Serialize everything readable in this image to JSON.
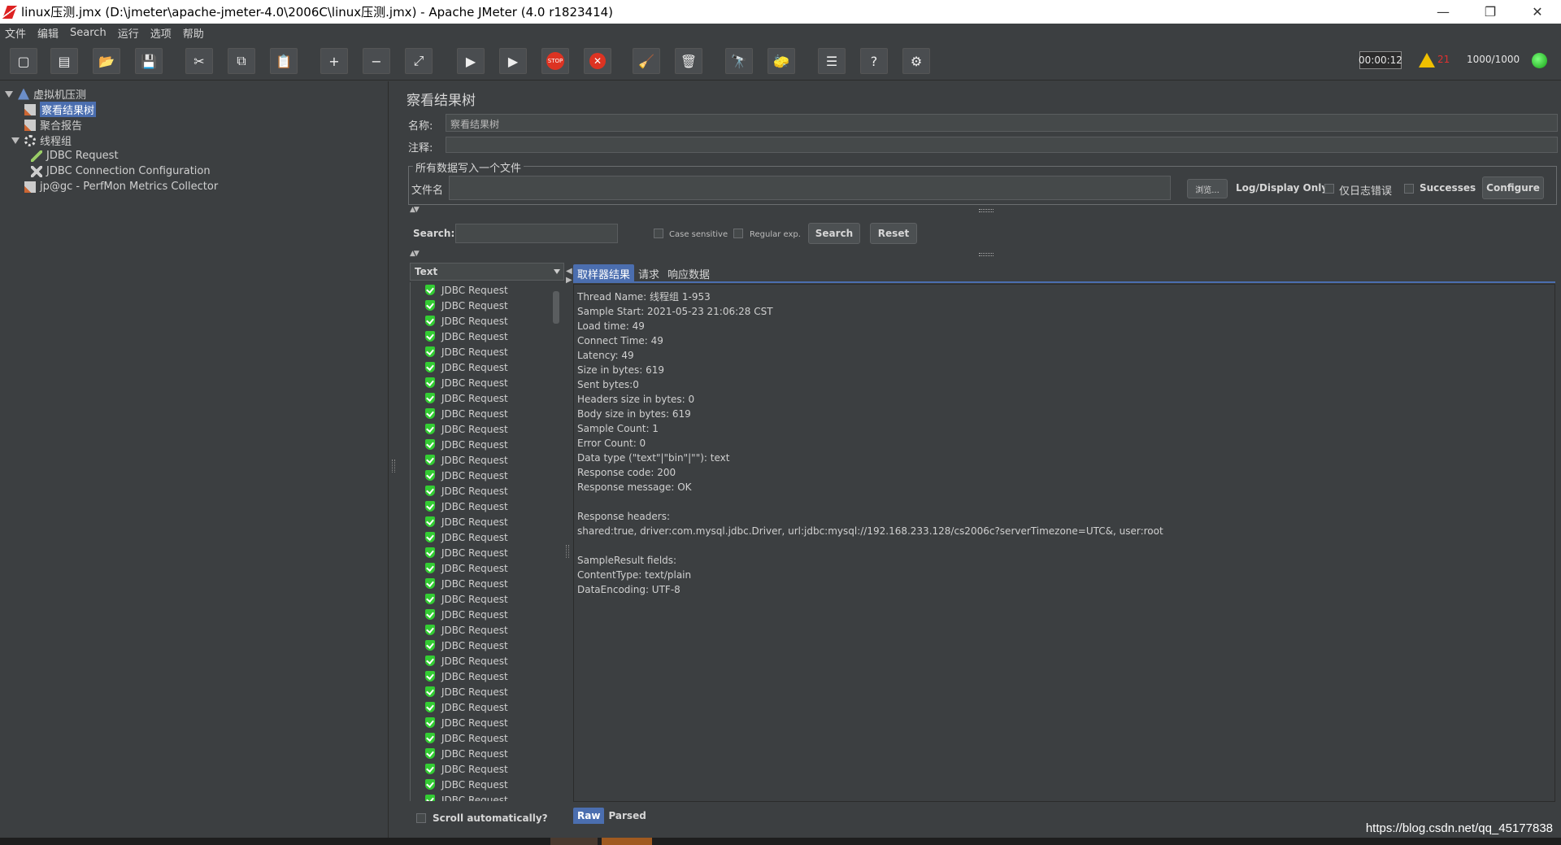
{
  "window": {
    "title": "linux压测.jmx (D:\\jmeter\\apache-jmeter-4.0\\2006C\\linux压测.jmx) - Apache JMeter (4.0 r1823414)",
    "controls": [
      "—",
      "❐",
      "✕"
    ]
  },
  "menu": [
    "文件",
    "编辑",
    "Search",
    "运行",
    "选项",
    "帮助"
  ],
  "toolbar": {
    "timer": "00:00:12",
    "warning_count": "21",
    "threads": "1000/1000"
  },
  "tree": {
    "root": "虚拟机压测",
    "selected": "察看结果树",
    "aggregate": "聚合报告",
    "thread_group": "线程组",
    "jdbc_request": "JDBC Request",
    "jdbc_config": "JDBC Connection Configuration",
    "perfmon": "jp@gc - PerfMon Metrics Collector"
  },
  "panel": {
    "title": "察看结果树",
    "name_label": "名称:",
    "name_value": "察看结果树",
    "comment_label": "注释:",
    "comment_value": "",
    "file_group": "所有数据写入一个文件",
    "filename_label": "文件名",
    "filename_value": "",
    "browse_button": "浏览...",
    "log_display_only": "Log/Display Only:",
    "errors_only": "仅日志错误",
    "successes": "Successes",
    "configure": "Configure"
  },
  "search": {
    "label": "Search:",
    "value": "",
    "case_sensitive": "Case sensitive",
    "regular_exp": "Regular exp.",
    "search_button": "Search",
    "reset_button": "Reset"
  },
  "results": {
    "renderer": "Text",
    "item_label": "JDBC Request",
    "item_count": 34,
    "scroll_auto": "Scroll automatically?"
  },
  "tabs": [
    "取样器结果",
    "请求",
    "响应数据"
  ],
  "bottom_tabs": [
    "Raw",
    "Parsed"
  ],
  "sample_result": [
    "Thread Name: 线程组 1-953",
    "Sample Start: 2021-05-23 21:06:28 CST",
    "Load time: 49",
    "Connect Time: 49",
    "Latency: 49",
    "Size in bytes: 619",
    "Sent bytes:0",
    "Headers size in bytes: 0",
    "Body size in bytes: 619",
    "Sample Count: 1",
    "Error Count: 0",
    "Data type (\"text\"|\"bin\"|\"\"): text",
    "Response code: 200",
    "Response message: OK",
    "",
    "Response headers:",
    "shared:true, driver:com.mysql.jdbc.Driver, url:jdbc:mysql://192.168.233.128/cs2006c?serverTimezone=UTC&, user:root",
    "",
    "SampleResult fields:",
    "ContentType: text/plain",
    "DataEncoding: UTF-8"
  ],
  "watermark": "https://blog.csdn.net/qq_45177838"
}
